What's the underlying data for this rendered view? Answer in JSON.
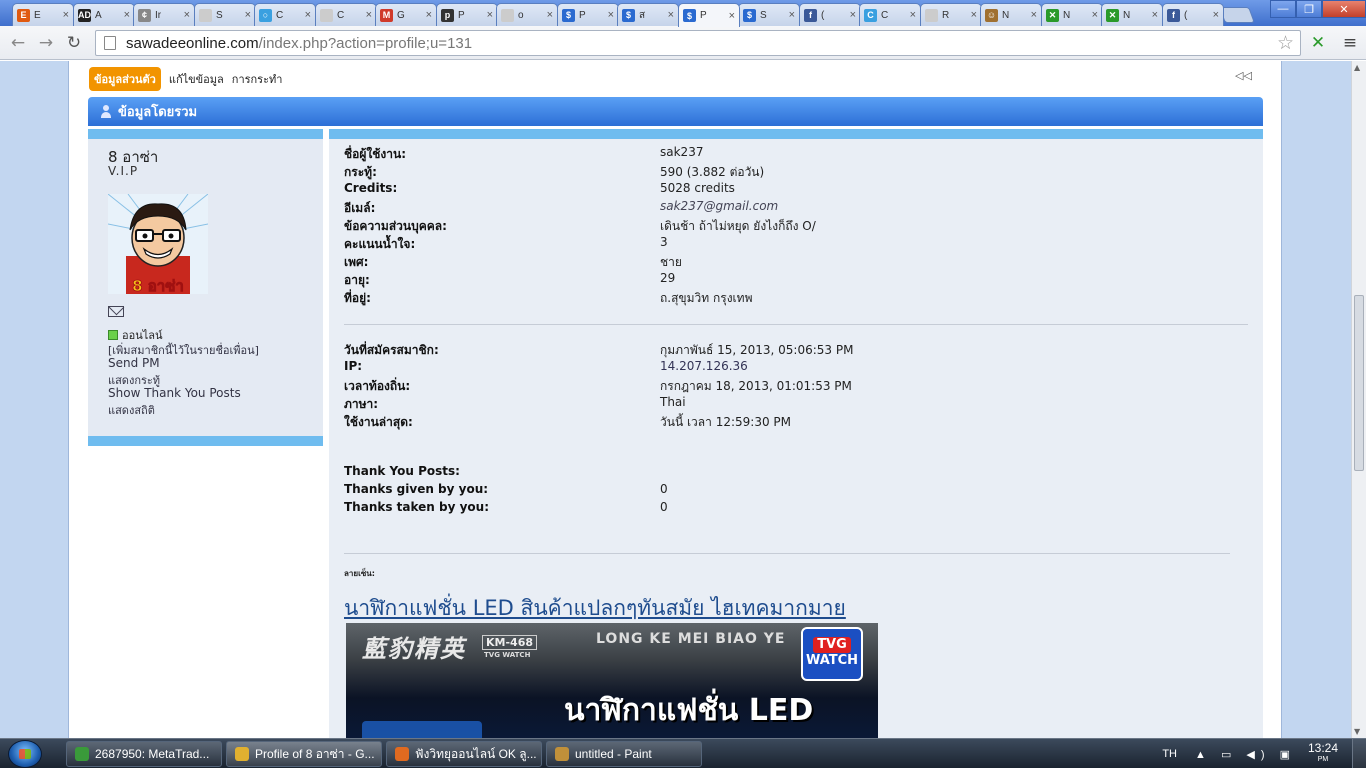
{
  "browser": {
    "tabs": [
      {
        "label": "E",
        "favicon": "E",
        "color": "#e05a10"
      },
      {
        "label": "A",
        "favicon": "AD",
        "color": "#222222"
      },
      {
        "label": "Ir",
        "favicon": "¢",
        "color": "#888888"
      },
      {
        "label": "S",
        "favicon": "",
        "color": "#cccccc"
      },
      {
        "label": "C",
        "favicon": "○",
        "color": "#3aa0e0"
      },
      {
        "label": "C",
        "favicon": "",
        "color": "#cccccc"
      },
      {
        "label": "G",
        "favicon": "M",
        "color": "#d03a2a"
      },
      {
        "label": "P",
        "favicon": "p",
        "color": "#333333"
      },
      {
        "label": "o",
        "favicon": "",
        "color": "#cccccc"
      },
      {
        "label": "P",
        "favicon": "$",
        "color": "#2a6ad0"
      },
      {
        "label": "ส",
        "favicon": "$",
        "color": "#2a6ad0"
      },
      {
        "label": "P",
        "favicon": "$",
        "color": "#2a6ad0"
      },
      {
        "label": "S",
        "favicon": "$",
        "color": "#2a6ad0"
      },
      {
        "label": "(",
        "favicon": "f",
        "color": "#3b5998"
      },
      {
        "label": "C",
        "favicon": "C",
        "color": "#3aa0e0"
      },
      {
        "label": "R",
        "favicon": "",
        "color": "#cccccc"
      },
      {
        "label": "N",
        "favicon": "☺",
        "color": "#a07030"
      },
      {
        "label": "N",
        "favicon": "✕",
        "color": "#2a9a2a"
      },
      {
        "label": "N",
        "favicon": "✕",
        "color": "#2a9a2a"
      },
      {
        "label": "(",
        "favicon": "f",
        "color": "#3b5998"
      }
    ],
    "active_tab_index": 11,
    "tab_close": "×",
    "url_host": "sawadeeonline.com",
    "url_path": "/index.php?action=profile;u=131",
    "back_icon": "←",
    "forward_icon": "→",
    "reload_icon": "↻",
    "star_icon": "☆",
    "menu_icon": "≡",
    "min_icon": "—",
    "max_icon": "❐",
    "close_icon": "✕"
  },
  "subnav": {
    "active": "ข้อมูลส่วนตัว",
    "edit": "แก้ไขข้อมูล",
    "actions": "การกระทำ",
    "collapse_icon": "◁◁"
  },
  "section_title": "ข้อมูลโดยรวม",
  "member": {
    "name": "8 อาซ่า",
    "rank": "V.I.P",
    "avatar_caption": "8 อาซ่า",
    "online_label": "ออนไลน์",
    "links": [
      "[เพิ่มสมาชิกนี้ไว้ในรายชื่อเพื่อน]",
      "Send PM",
      "แสดงกระทู้",
      "Show Thank You Posts",
      "แสดงสถิติ"
    ]
  },
  "profile": {
    "basic": [
      {
        "label": "ชื่อผู้ใช้งาน:",
        "value": "sak237"
      },
      {
        "label": "กระทู้:",
        "value": "590 (3.882 ต่อวัน)"
      },
      {
        "label": "Credits:",
        "value": "5028 credits"
      },
      {
        "label": "อีเมล์:",
        "value": "sak237@gmail.com"
      },
      {
        "label": "ข้อความส่วนบุคคล:",
        "value": "เดินช้า ถ้าไม่หยุด ยังไงก็ถึง O/"
      },
      {
        "label": "คะแนนน้ำใจ:",
        "value": "3"
      },
      {
        "label": "เพศ:",
        "value": "ชาย"
      },
      {
        "label": "อายุ:",
        "value": "29"
      },
      {
        "label": "ที่อยู่:",
        "value": "ถ.สุขุมวิท กรุงเทพ"
      }
    ],
    "activity": [
      {
        "label": "วันที่สมัครสมาชิก:",
        "value": "กุมภาพันธ์ 15, 2013, 05:06:53 PM"
      },
      {
        "label": "IP:",
        "value": "14.207.126.36"
      },
      {
        "label": "เวลาท้องถิ่น:",
        "value": "กรกฎาคม 18, 2013, 01:01:53 PM"
      },
      {
        "label": "ภาษา:",
        "value": "Thai"
      },
      {
        "label": "ใช้งานล่าสุด:",
        "value": "วันนี้ เวลา 12:59:30 PM"
      }
    ],
    "thanks": [
      {
        "label": "Thank You Posts:",
        "value": ""
      },
      {
        "label": "Thanks given by you:",
        "value": "0"
      },
      {
        "label": "Thanks taken by you:",
        "value": "0"
      }
    ],
    "signature_label": "ลายเซ็น:",
    "signature_link": "นาฬิกาแฟชั่น LED สินค้าแปลกๆทันสมัย ไฮเทคมากมาย",
    "banner": {
      "left_text": "藍豹精英",
      "code": "KM-468",
      "code_sub": "TVG WATCH",
      "brand": "LONG KE MEI BIAO YE",
      "tvg_top": "TVG",
      "tvg_bottom": "WATCH",
      "main": "นาฬิกาแฟชั่น LED"
    }
  },
  "taskbar": {
    "items": [
      {
        "label": "2687950: MetaTrad...",
        "color": "#3a9a3a"
      },
      {
        "label": "Profile of 8 อาซ่า - G...",
        "color": "#e0b030"
      },
      {
        "label": "ฟังวิทยุออนไลน์ OK ลู...",
        "color": "#e06a20"
      },
      {
        "label": "untitled - Paint",
        "color": "#c0903a"
      }
    ],
    "active_index": 1,
    "lang": "TH",
    "tray_icons": "▲ ▭ ◀) ▣",
    "time": "13:24",
    "am_pm": "PM"
  }
}
